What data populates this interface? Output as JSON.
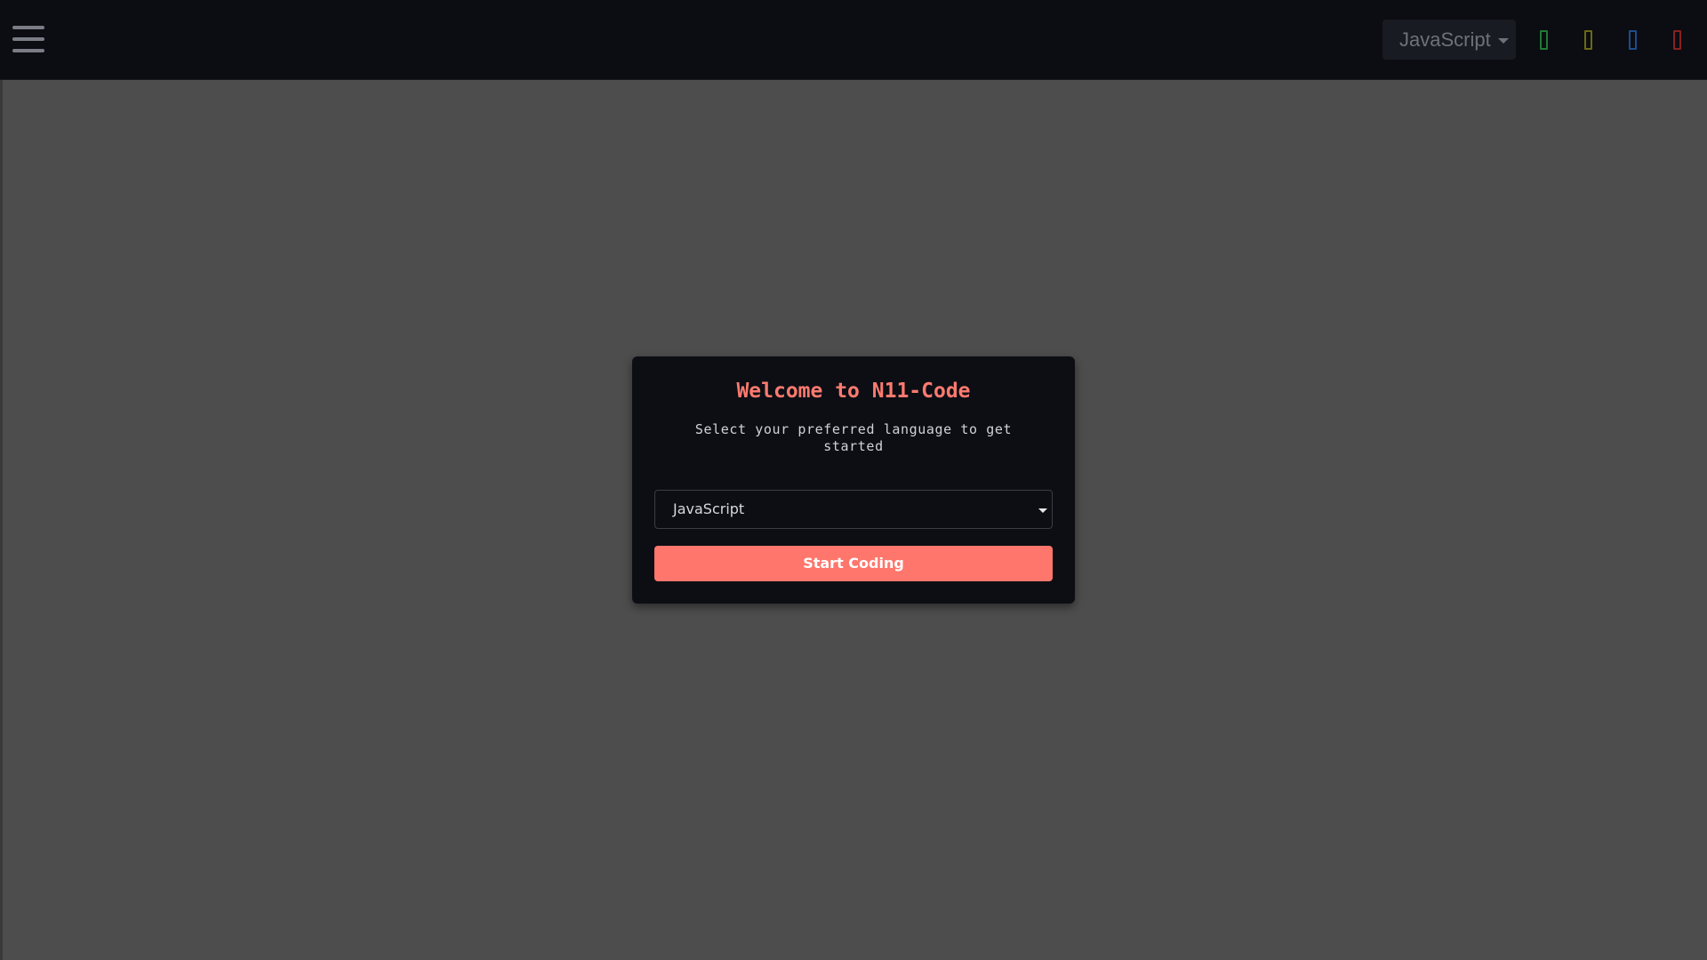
{
  "topbar": {
    "menu_icon": "hamburger-menu-icon",
    "language_select": {
      "selected": "JavaScript"
    },
    "icons": [
      {
        "name": "run-icon",
        "color": "#1f7a34"
      },
      {
        "name": "format-icon",
        "color": "#6b6a14"
      },
      {
        "name": "share-icon",
        "color": "#1d4d8a"
      },
      {
        "name": "clear-icon",
        "color": "#8a2020"
      }
    ]
  },
  "modal": {
    "title": "Welcome to N11-Code",
    "subtitle": "Select your preferred language to get started",
    "language_select": {
      "selected": "JavaScript"
    },
    "start_button_label": "Start Coding"
  },
  "colors": {
    "accent": "#ff766c",
    "topbar_bg": "#0b0d12",
    "overlay_bg": "#4d4d4d",
    "modal_bg": "#0c0e14"
  }
}
